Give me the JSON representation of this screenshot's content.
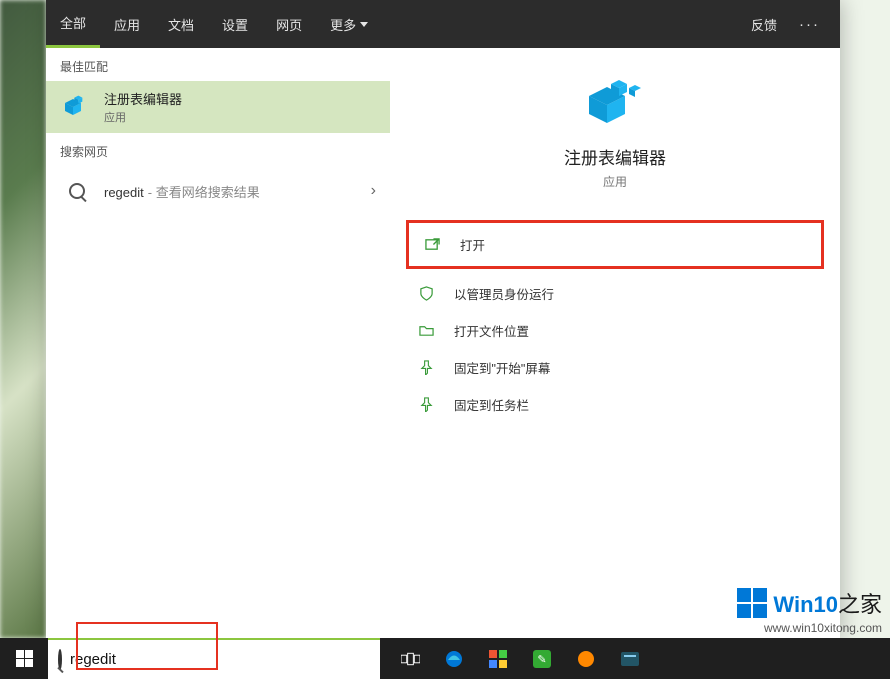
{
  "tabs": {
    "all": "全部",
    "apps": "应用",
    "docs": "文档",
    "settings": "设置",
    "web": "网页",
    "more": "更多"
  },
  "header": {
    "feedback": "反馈",
    "ellipsis": "···"
  },
  "sections": {
    "best_match": "最佳匹配",
    "search_web": "搜索网页"
  },
  "best_match": {
    "title": "注册表编辑器",
    "subtitle": "应用"
  },
  "web_result": {
    "term": "regedit",
    "hint": " - 查看网络搜索结果",
    "chevron": "›"
  },
  "preview": {
    "title": "注册表编辑器",
    "subtitle": "应用"
  },
  "actions": {
    "open": "打开",
    "run_admin": "以管理员身份运行",
    "open_location": "打开文件位置",
    "pin_start": "固定到\"开始\"屏幕",
    "pin_taskbar": "固定到任务栏"
  },
  "searchbox": {
    "value": "regedit"
  },
  "watermark": {
    "brand_a": "Win10",
    "brand_b": "之家",
    "url": "www.win10xitong.com"
  },
  "colors": {
    "accent": "#8cc63f",
    "highlight_border": "#e53120",
    "win_blue": "#0078d7"
  }
}
